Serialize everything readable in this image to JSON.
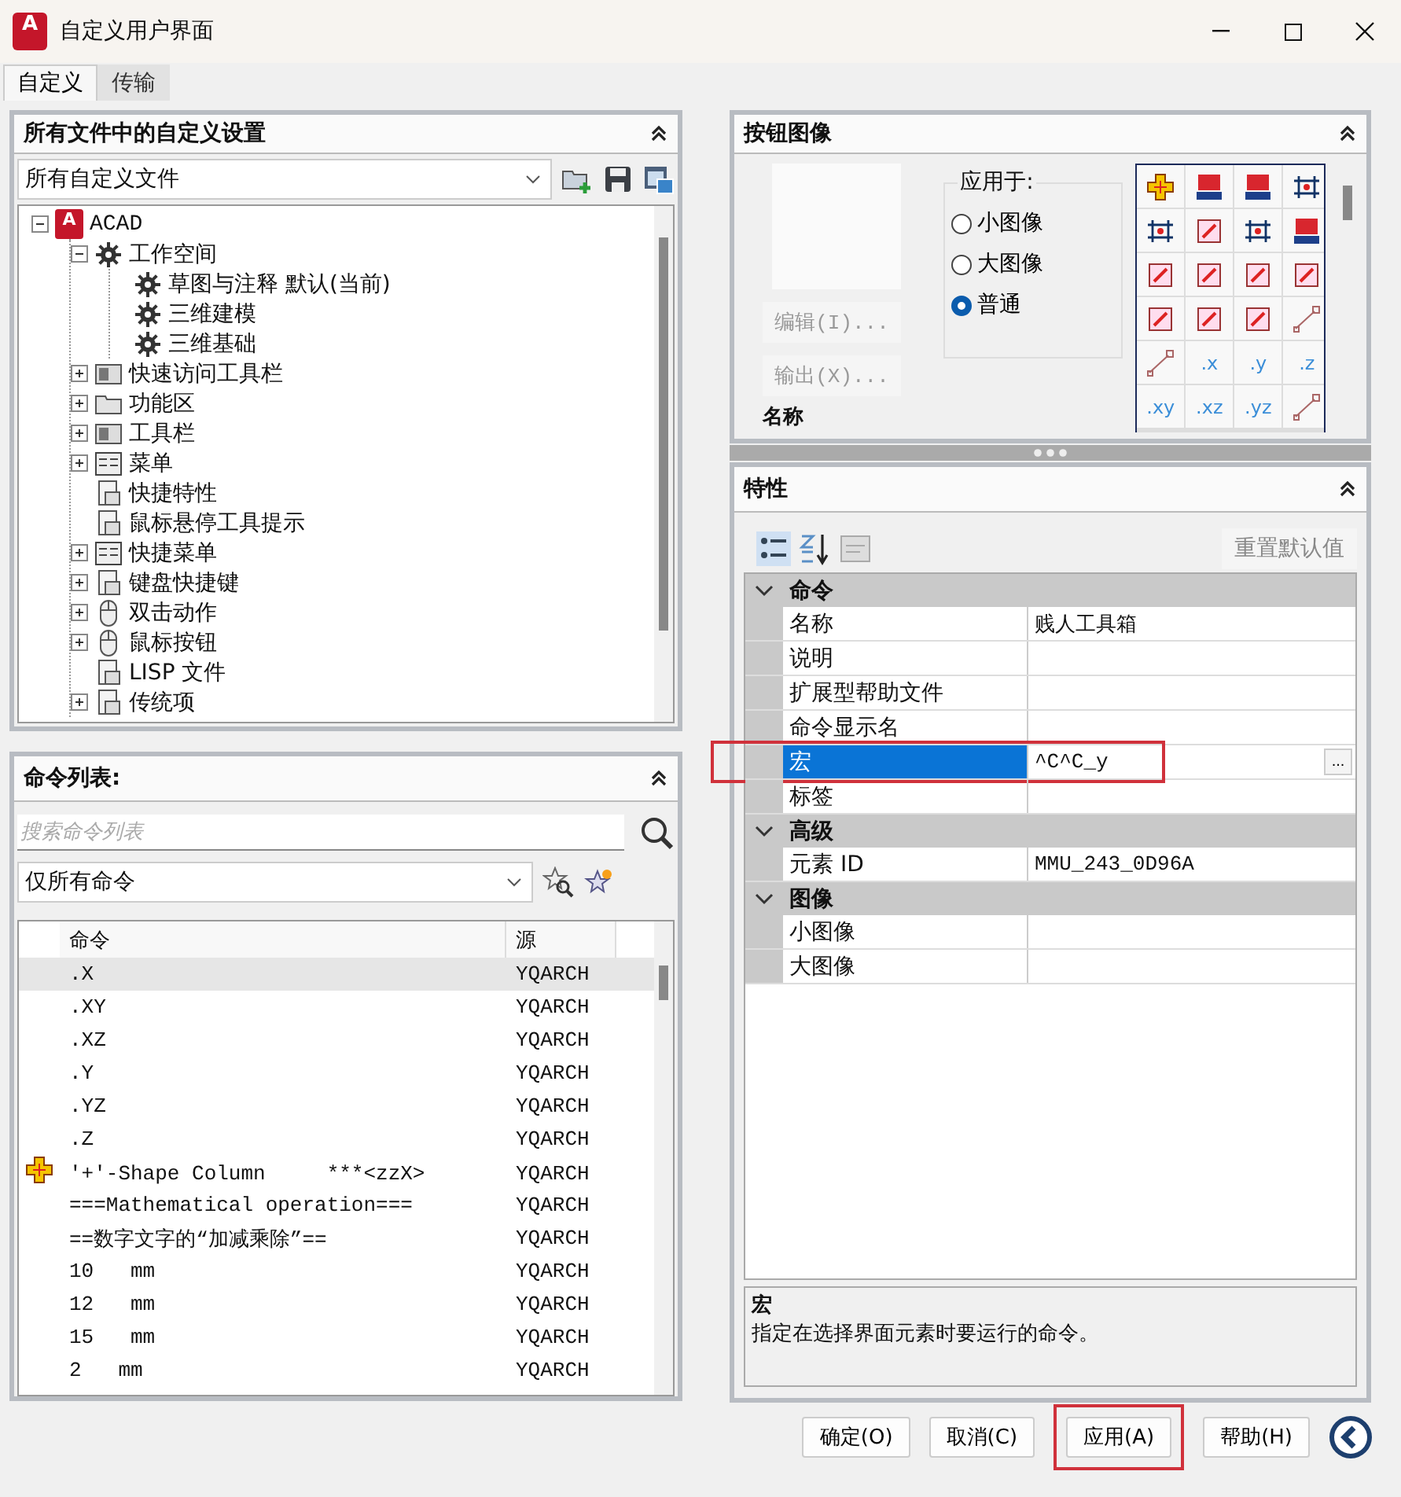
{
  "window": {
    "title": "自定义用户界面",
    "logo_text": "A"
  },
  "tabs": [
    {
      "label": "自定义",
      "selected": true
    },
    {
      "label": "传输",
      "selected": false
    }
  ],
  "customizations": {
    "title": "所有文件中的自定义设置",
    "dropdown": "所有自定义文件",
    "tree": [
      {
        "label": "ACAD",
        "kind": "app",
        "icon_text": "A",
        "expanded": true,
        "children": [
          {
            "label": "工作空间",
            "kind": "gears",
            "expanded": true,
            "children": [
              {
                "label": "草图与注释 默认(当前)",
                "kind": "gear"
              },
              {
                "label": "三维建模",
                "kind": "gear"
              },
              {
                "label": "三维基础",
                "kind": "gear"
              }
            ]
          },
          {
            "label": "快速访问工具栏",
            "kind": "toolbar",
            "expanded": false
          },
          {
            "label": "功能区",
            "kind": "folder",
            "expanded": false
          },
          {
            "label": "工具栏",
            "kind": "toolbar",
            "expanded": false
          },
          {
            "label": "菜单",
            "kind": "menu",
            "expanded": false
          },
          {
            "label": "快捷特性",
            "kind": "doc"
          },
          {
            "label": "鼠标悬停工具提示",
            "kind": "doc"
          },
          {
            "label": "快捷菜单",
            "kind": "menu",
            "expanded": false
          },
          {
            "label": "键盘快捷键",
            "kind": "doc",
            "expanded": false
          },
          {
            "label": "双击动作",
            "kind": "mouse",
            "expanded": false
          },
          {
            "label": "鼠标按钮",
            "kind": "mouse",
            "expanded": false
          },
          {
            "label": "LISP 文件",
            "kind": "doc"
          },
          {
            "label": "传统项",
            "kind": "doc",
            "expanded": false
          }
        ]
      }
    ]
  },
  "commands": {
    "title": "命令列表:",
    "search": {
      "placeholder": "搜索命令列表"
    },
    "filter": "仅所有命令",
    "columns": [
      "命令",
      "源"
    ],
    "rows": [
      {
        "command": ".X",
        "source": "YQARCH",
        "selected": true,
        "kind": "plain"
      },
      {
        "command": ".XY",
        "source": "YQARCH",
        "selected": false,
        "kind": "plain"
      },
      {
        "command": ".XZ",
        "source": "YQARCH",
        "selected": false,
        "kind": "plain"
      },
      {
        "command": ".Y",
        "source": "YQARCH",
        "selected": false,
        "kind": "plain"
      },
      {
        "command": ".YZ",
        "source": "YQARCH",
        "selected": false,
        "kind": "plain"
      },
      {
        "command": ".Z",
        "source": "YQARCH",
        "selected": false,
        "kind": "plain"
      },
      {
        "command": "'+'-Shape Column     ***<zzX>",
        "source": "YQARCH",
        "selected": false,
        "kind": "icon"
      },
      {
        "command": "===Mathematical operation===",
        "source": "YQARCH",
        "selected": false,
        "kind": "plain"
      },
      {
        "command": "==数字文字的“加减乘除”==",
        "source": "YQARCH",
        "selected": false,
        "kind": "plain"
      },
      {
        "command": "10   mm",
        "source": "YQARCH",
        "selected": false,
        "kind": "plain"
      },
      {
        "command": "12   mm",
        "source": "YQARCH",
        "selected": false,
        "kind": "plain"
      },
      {
        "command": "15   mm",
        "source": "YQARCH",
        "selected": false,
        "kind": "plain"
      },
      {
        "command": "2   mm",
        "source": "YQARCH",
        "selected": false,
        "kind": "plain"
      }
    ]
  },
  "button_image": {
    "title": "按钮图像",
    "apply_to": {
      "label": "应用于:",
      "options": [
        {
          "label": "小图像",
          "selected": false
        },
        {
          "label": "大图像",
          "selected": false
        },
        {
          "label": "普通",
          "selected": true
        }
      ]
    },
    "buttons": [
      {
        "label": "编辑(I)...",
        "disabled": true
      },
      {
        "label": "输出(X)...",
        "disabled": true
      }
    ],
    "name_label": "名称",
    "icons": [
      {
        "kind": "cross"
      },
      {
        "kind": "area"
      },
      {
        "kind": "area"
      },
      {
        "kind": "dim"
      },
      {
        "kind": "dim"
      },
      {
        "kind": "frame"
      },
      {
        "kind": "dim"
      },
      {
        "kind": "area"
      },
      {
        "kind": "frame"
      },
      {
        "kind": "frame"
      },
      {
        "kind": "frame"
      },
      {
        "kind": "frame"
      },
      {
        "kind": "frame"
      },
      {
        "kind": "frame"
      },
      {
        "kind": "frame"
      },
      {
        "kind": "line"
      },
      {
        "kind": "line"
      },
      {
        "kind": "label",
        "label": ".x"
      },
      {
        "kind": "label",
        "label": ".y"
      },
      {
        "kind": "label",
        "label": ".z"
      },
      {
        "kind": "label",
        "label": ".xy"
      },
      {
        "kind": "label",
        "label": ".xz"
      },
      {
        "kind": "label",
        "label": ".yz"
      },
      {
        "kind": "line"
      }
    ]
  },
  "properties": {
    "title": "特性",
    "reset": {
      "label": "重置默认值",
      "disabled": true
    },
    "categories": [
      {
        "name": "命令",
        "expanded": true,
        "rows": [
          {
            "name": "名称",
            "value": "贱人工具箱",
            "selected": false
          },
          {
            "name": "说明",
            "selected": false
          },
          {
            "name": "扩展型帮助文件",
            "selected": false
          },
          {
            "name": "命令显示名",
            "selected": false
          },
          {
            "name": "宏",
            "value": "^C^C_y",
            "selected": true,
            "highlighted": true,
            "browse": "..."
          },
          {
            "name": "标签",
            "selected": false
          }
        ]
      },
      {
        "name": "高级",
        "expanded": true,
        "rows": [
          {
            "name": "元素 ID",
            "value": "MMU_243_0D96A",
            "selected": false
          }
        ]
      },
      {
        "name": "图像",
        "expanded": true,
        "rows": [
          {
            "name": "小图像",
            "selected": false
          },
          {
            "name": "大图像",
            "selected": false
          }
        ]
      }
    ],
    "description": {
      "title": "宏",
      "text": "指定在选择界面元素时要运行的命令。"
    }
  },
  "footer": {
    "buttons": [
      {
        "label": "确定(O)",
        "highlighted": false
      },
      {
        "label": "取消(C)",
        "highlighted": false
      },
      {
        "label": "应用(A)",
        "highlighted": true
      },
      {
        "label": "帮助(H)",
        "highlighted": false
      }
    ]
  }
}
